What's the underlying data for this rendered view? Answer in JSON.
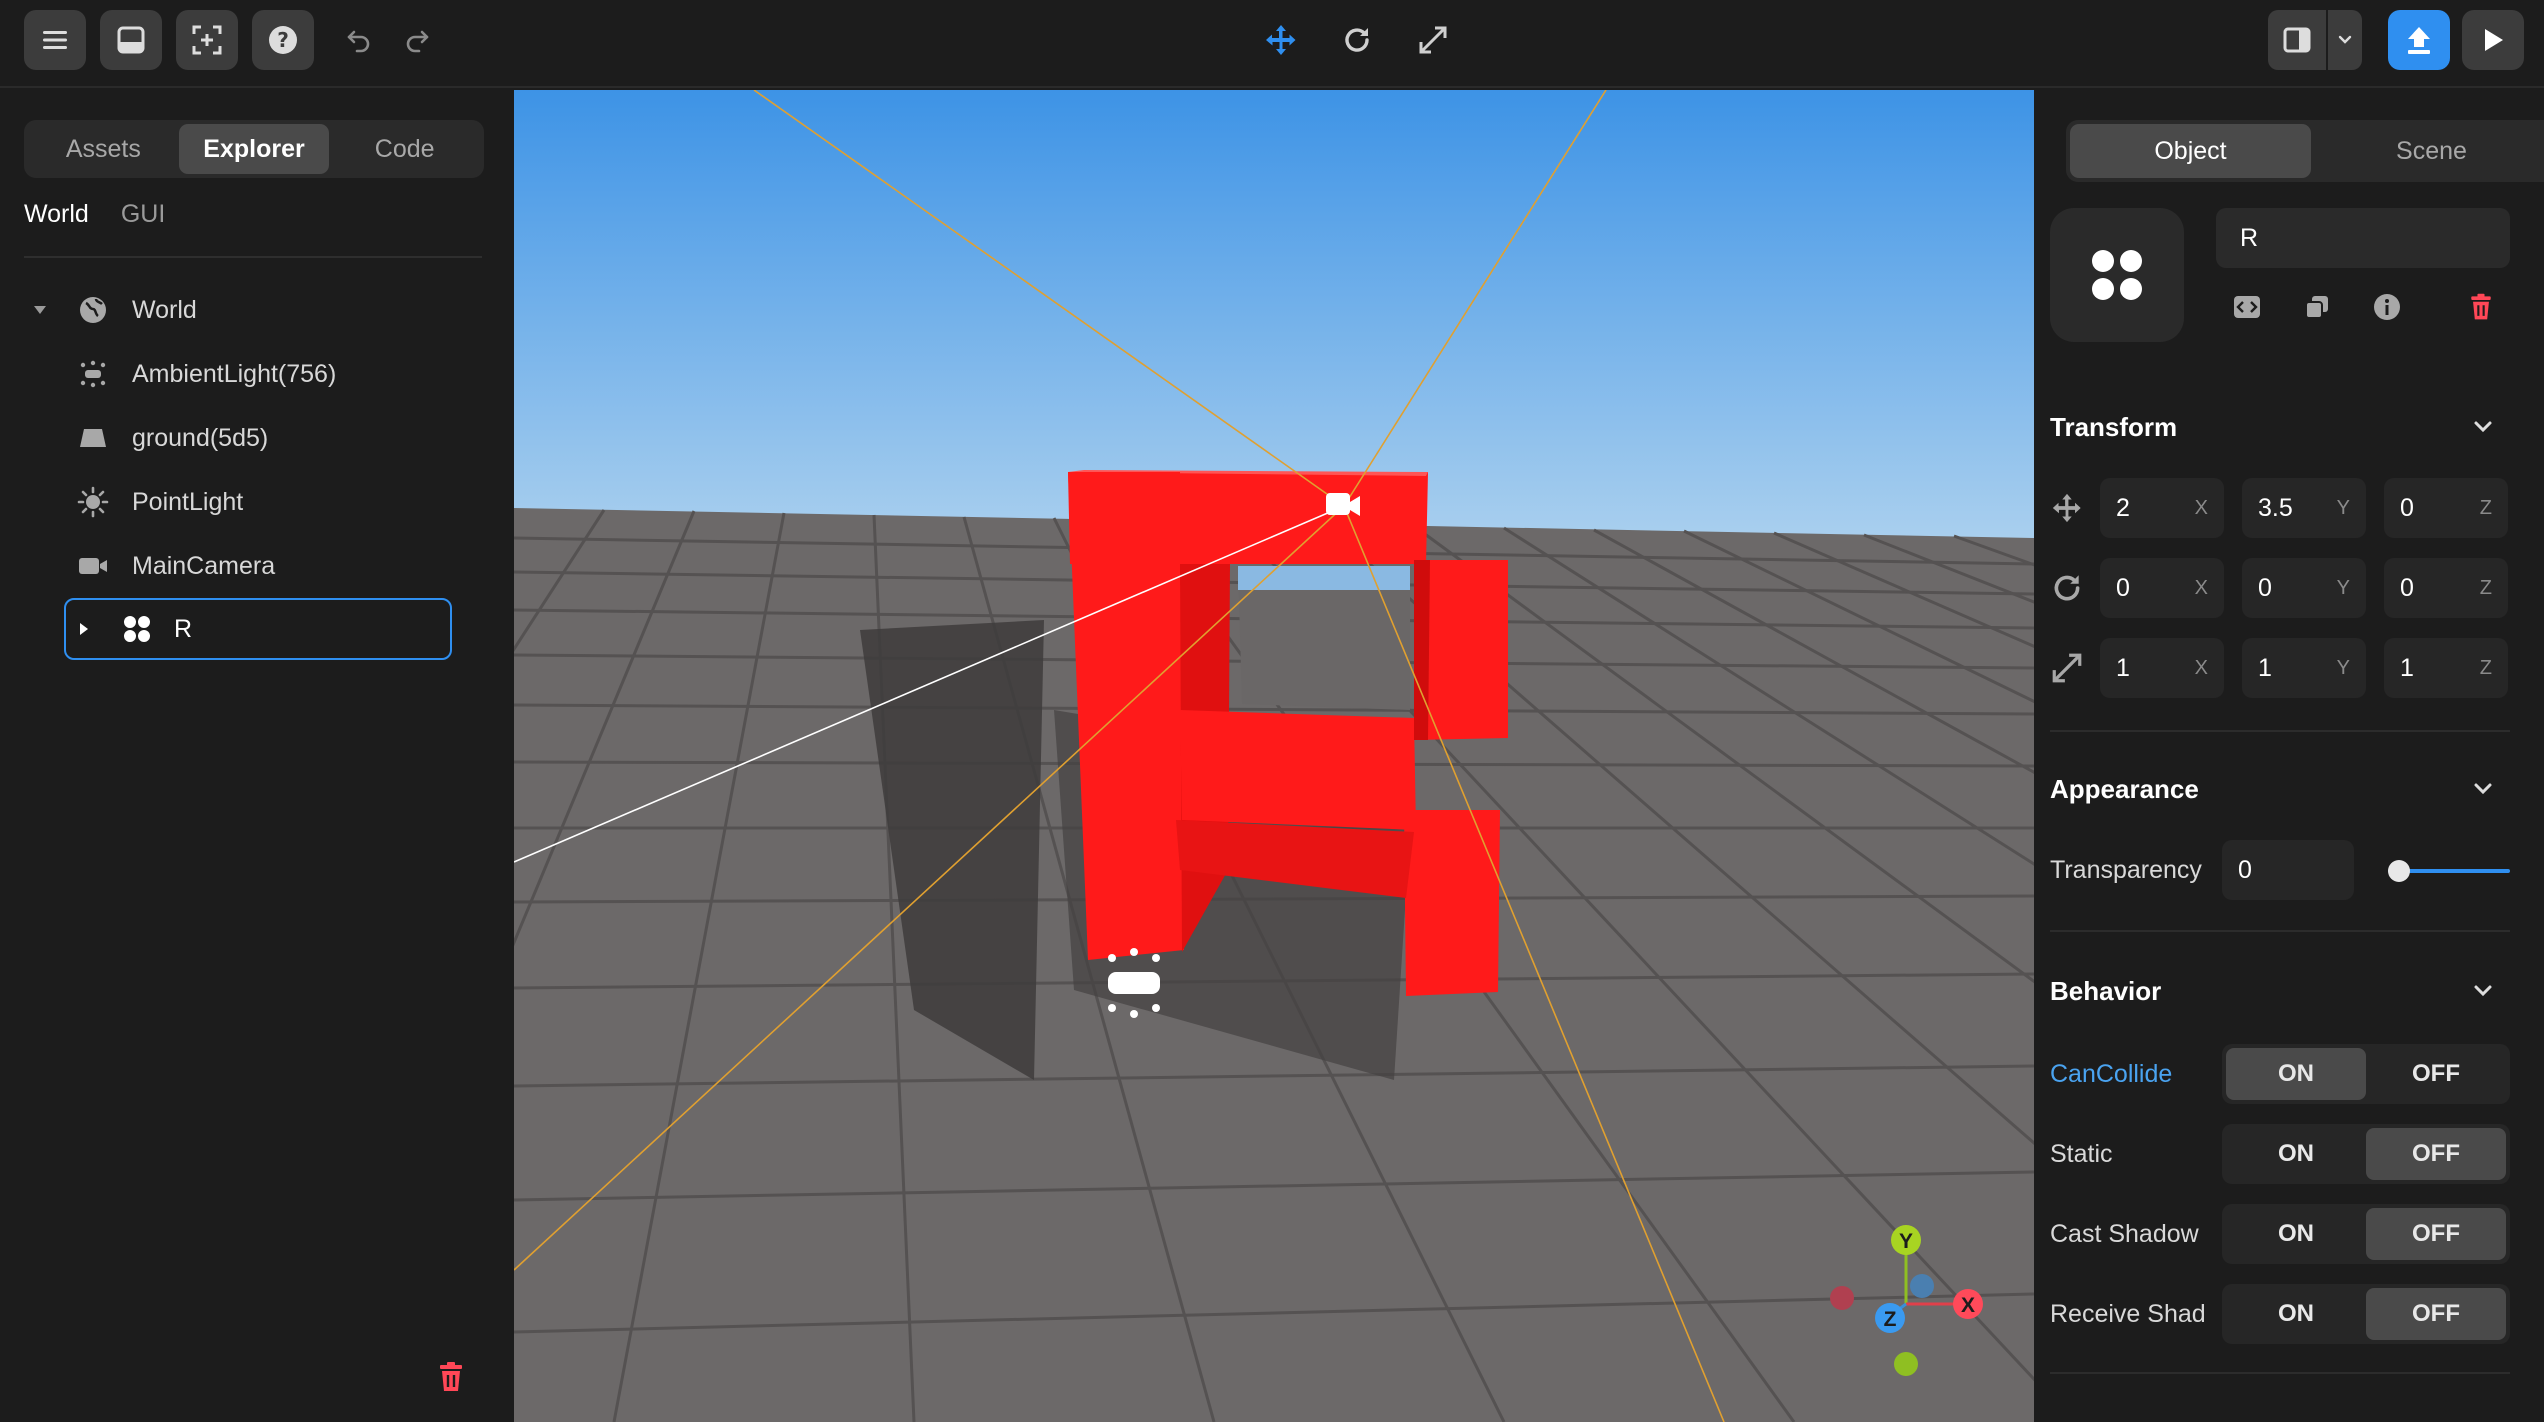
{
  "toolbar": {
    "left_icons": [
      "menu-icon",
      "inbox-icon",
      "select-frame-icon",
      "help-icon",
      "undo-icon",
      "redo-icon"
    ],
    "center_icons": [
      "move-icon",
      "rotate-icon",
      "scale-icon"
    ],
    "right_icons": [
      "panel-layout-icon",
      "chevron-down-icon",
      "publish-icon",
      "play-icon"
    ],
    "accent": "#2f8ff0"
  },
  "left_panel": {
    "tabs": [
      {
        "label": "Assets",
        "active": false
      },
      {
        "label": "Explorer",
        "active": true
      },
      {
        "label": "Code",
        "active": false
      }
    ],
    "subtabs": [
      {
        "label": "World",
        "active": true
      },
      {
        "label": "GUI",
        "active": false
      }
    ],
    "tree": [
      {
        "label": "World",
        "icon": "globe-icon",
        "expanded": true
      },
      {
        "label": "AmbientLight(756)",
        "icon": "ambient-light-icon"
      },
      {
        "label": "ground(5d5)",
        "icon": "ground-icon"
      },
      {
        "label": "PointLight",
        "icon": "point-light-icon"
      },
      {
        "label": "MainCamera",
        "icon": "camera-icon"
      },
      {
        "label": "R",
        "icon": "group-icon",
        "selected": true
      }
    ]
  },
  "viewport": {
    "sky_top": "#3d93e6",
    "sky_bottom": "#a9cfee",
    "ground": "#6b6868",
    "object_color": "#ff1a1a",
    "axis_labels": {
      "x": "X",
      "y": "Y",
      "z": "Z"
    }
  },
  "right_panel": {
    "tabs": [
      {
        "label": "Object",
        "active": true
      },
      {
        "label": "Scene",
        "active": false
      }
    ],
    "object_name": "R",
    "sections": {
      "transform": "Transform",
      "appearance": "Appearance",
      "behavior": "Behavior"
    },
    "transform": {
      "position": {
        "x": "2",
        "y": "3.5",
        "z": "0"
      },
      "rotation": {
        "x": "0",
        "y": "0",
        "z": "0"
      },
      "scale": {
        "x": "1",
        "y": "1",
        "z": "1"
      },
      "axis": {
        "x": "X",
        "y": "Y",
        "z": "Z"
      }
    },
    "appearance": {
      "transparency_label": "Transparency",
      "transparency_value": "0"
    },
    "behavior": [
      {
        "label": "CanCollide",
        "on": "ON",
        "off": "OFF",
        "state": "on"
      },
      {
        "label": "Static",
        "on": "ON",
        "off": "OFF",
        "state": "off"
      },
      {
        "label": "Cast Shadow",
        "on": "ON",
        "off": "OFF",
        "state": "off"
      },
      {
        "label": "Receive Shad",
        "on": "ON",
        "off": "OFF",
        "state": "off"
      }
    ]
  }
}
